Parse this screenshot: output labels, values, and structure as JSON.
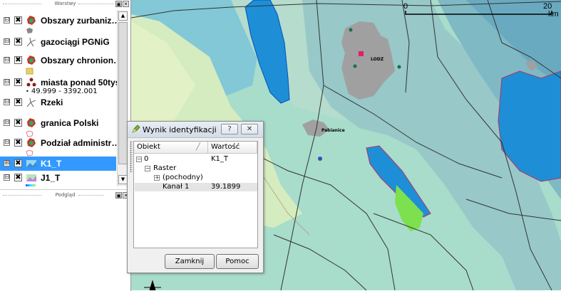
{
  "layers_panel": {
    "title": "Warstwy",
    "layers": [
      {
        "name": "Obszary zurbaniz…",
        "icon": "polygon-layer-icon",
        "checked": "✖",
        "expander": "⊟"
      },
      {
        "name": "gazociągi PGNiG",
        "icon": "line-layer-icon",
        "checked": "✖",
        "expander": "⊟"
      },
      {
        "name": "Obszary chronion…",
        "icon": "polygon-layer-icon",
        "checked": "✖",
        "expander": "⊟"
      },
      {
        "name": "miasta ponad 50tys",
        "icon": "point-layer-icon",
        "checked": "✖",
        "expander": "⊟",
        "legend": "49.999 - 3392.001"
      },
      {
        "name": "Rzeki",
        "icon": "line-layer-icon",
        "checked": "✖",
        "expander": "⊟"
      },
      {
        "name": "granica Polski",
        "icon": "polygon-layer-icon",
        "checked": "✖",
        "expander": "⊟"
      },
      {
        "name": "Podział administr…",
        "icon": "polygon-layer-icon",
        "checked": "✖",
        "expander": "⊟"
      },
      {
        "name": "K1_T",
        "icon": "raster-layer-icon",
        "checked": "✖",
        "expander": "⊞"
      },
      {
        "name": "J1_T",
        "icon": "raster-layer-icon",
        "checked": "✖",
        "expander": "⊟"
      }
    ]
  },
  "overview_panel": {
    "title": "Podgląd"
  },
  "map": {
    "city_label": "LODZ",
    "town_label": "Pabianice",
    "scale_start": "0",
    "scale_end": "20",
    "scale_unit": "km",
    "colors": {
      "urban": "#a0a0a0",
      "water": "#1e8fd6",
      "green": "#7de04e",
      "base": "#a8dccb",
      "pale": "#d5ecc0"
    }
  },
  "identify_dialog": {
    "title": "Wynik identyfikacji",
    "help_btn": "?",
    "close_btn": "✕",
    "col_feature": "Obiekt",
    "col_value": "Wartość",
    "rows": [
      {
        "key": "0",
        "value": "K1_T"
      },
      {
        "key": "Raster",
        "value": ""
      },
      {
        "key": "(pochodny)",
        "value": ""
      },
      {
        "key": "Kanał 1",
        "value": "39.1899"
      }
    ],
    "close_button": "Zamknij",
    "help_button": "Pomoc"
  }
}
